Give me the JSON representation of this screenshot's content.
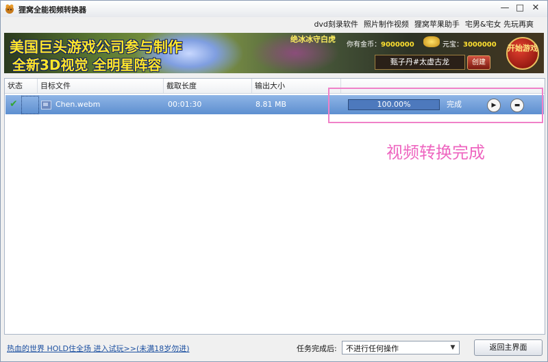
{
  "window": {
    "title": "狸窝全能视频转换器",
    "minimize": "—",
    "maximize": "□",
    "close": "✕"
  },
  "toplinks": [
    "dvd刻录软件",
    "照片制作视频",
    "狸窝苹果助手",
    "宅男&宅女 先玩再爽"
  ],
  "banner": {
    "line1": "美国巨头游戏公司参与制作",
    "line2": "全新3D视觉 全明星阵容",
    "tag": "绝冰冰守白虎",
    "gold_label": "你有金币：",
    "gold_value": "9000000",
    "yuanbao_label": "元宝：",
    "yuanbao_value": "3000000",
    "name": "甄子丹#太虚古龙",
    "create": "创建",
    "start": "开始游戏"
  },
  "table": {
    "columns": [
      "状态",
      "目标文件",
      "截取长度",
      "输出大小"
    ],
    "rows": [
      {
        "file": "Chen.webm",
        "length": "00:01:30",
        "size": "8.81 MB",
        "progress": "100.00%",
        "progress_fraction": 1.0,
        "status": "完成"
      }
    ]
  },
  "annotation": "视频转换完成",
  "bottom": {
    "promo": "热血的世界 HOLD住全场 进入试玩>>(未满18岁勿进)",
    "after_label": "任务完成后:",
    "after_value": "不进行任何操作",
    "back_button": "返回主界面"
  }
}
